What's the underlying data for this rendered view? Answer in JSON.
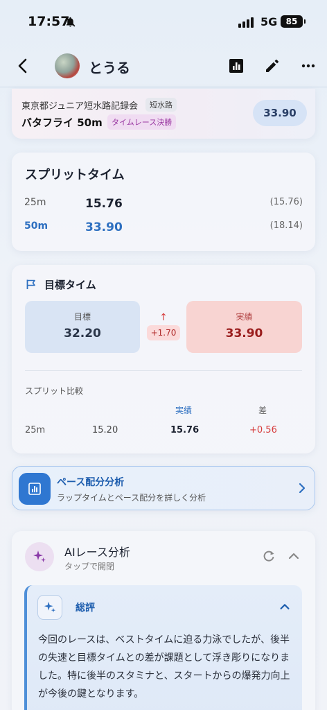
{
  "status_bar": {
    "time": "17:57",
    "network": "5G",
    "battery": "85"
  },
  "nav": {
    "title": "とうる",
    "icons": [
      "back-icon",
      "chart-icon",
      "edit-icon",
      "more-icon"
    ]
  },
  "race": {
    "meet": "東京都ジュニア短水路記録会",
    "pool_badge": "短水路",
    "event": "バタフライ 50m",
    "final_badge": "タイムレース決勝",
    "time": "33.90"
  },
  "splits": {
    "title": "スプリットタイム",
    "rows": [
      {
        "dist": "25m",
        "time": "15.76",
        "lap": "(15.76)"
      },
      {
        "dist": "50m",
        "time": "33.90",
        "lap": "(18.14)"
      }
    ]
  },
  "target": {
    "title": "目標タイム",
    "target_label": "目標",
    "target_value": "32.20",
    "actual_label": "実績",
    "actual_value": "33.90",
    "arrow": "↑",
    "diff": "+1.70",
    "compare_title": "スプリット比較",
    "compare_headers": {
      "actual": "実績",
      "diff": "差"
    },
    "compare_rows": [
      {
        "dist": "25m",
        "target": "15.20",
        "actual": "15.76",
        "diff": "+0.56"
      }
    ]
  },
  "pace": {
    "title": "ペース配分分析",
    "subtitle": "ラップタイムとペース配分を詳しく分析"
  },
  "ai": {
    "title": "AIレース分析",
    "subtitle": "タップで開閉",
    "summary_title": "総評",
    "summary_text": "今回のレースは、ベストタイムに迫る力泳でしたが、後半の失速と目標タイムとの差が課題として浮き彫りになりました。特に後半のスタミナと、スタートからの爆発力向上が今後の鍵となります。"
  },
  "colors": {
    "accent": "#2d6fc0",
    "danger": "#b02a2a",
    "ai_purple": "#9b3aa3"
  }
}
